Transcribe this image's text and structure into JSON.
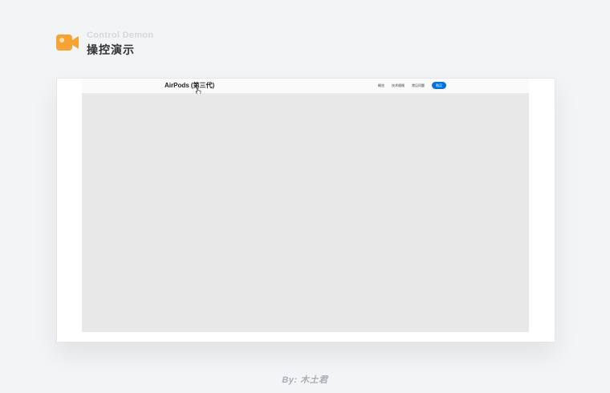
{
  "header": {
    "subtitle": "Control Demon",
    "title": "操控演示",
    "icon": "video-camera-icon",
    "accent_color": "#f7a234"
  },
  "navbar": {
    "product_name": "AirPods (第三代)",
    "links": [
      "概览",
      "技术规格",
      "常见问题"
    ],
    "buy_label": "购买",
    "buy_color": "#0071e3"
  },
  "footer": {
    "credit": "By: 木土君"
  }
}
